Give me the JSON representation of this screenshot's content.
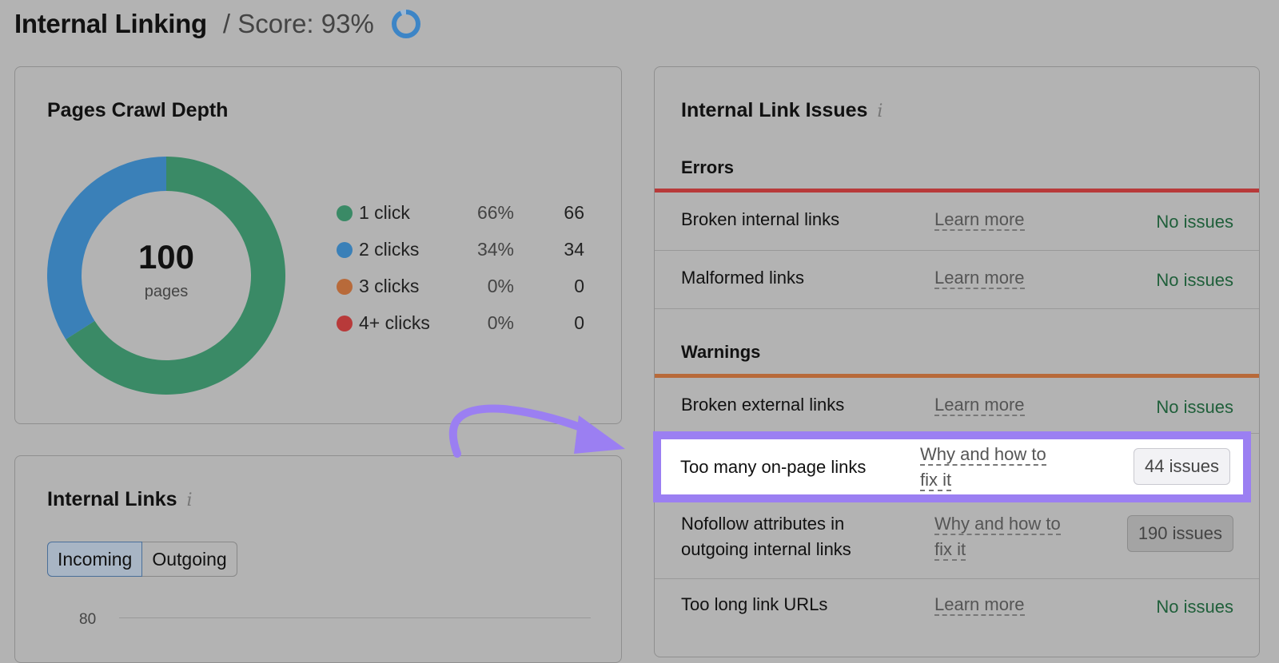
{
  "header": {
    "title": "Internal Linking",
    "score_label": "/ Score: 93%",
    "score_value": 93
  },
  "crawl_depth": {
    "title": "Pages Crawl Depth",
    "center_count": "100",
    "center_unit": "pages",
    "chart_data": {
      "type": "pie",
      "categories": [
        "1 click",
        "2 clicks",
        "3 clicks",
        "4+ clicks"
      ],
      "values": [
        66,
        34,
        0,
        0
      ],
      "colors": [
        "#3a8a66",
        "#3a80b8",
        "#b86a3a",
        "#b83a3a"
      ]
    },
    "legend": [
      {
        "label": "1 click",
        "percent": "66%",
        "value": "66",
        "color": "#3a8a66"
      },
      {
        "label": "2 clicks",
        "percent": "34%",
        "value": "34",
        "color": "#3a80b8"
      },
      {
        "label": "3 clicks",
        "percent": "0%",
        "value": "0",
        "color": "#b86a3a"
      },
      {
        "label": "4+ clicks",
        "percent": "0%",
        "value": "0",
        "color": "#b83a3a"
      }
    ]
  },
  "internal_links": {
    "title": "Internal Links",
    "info_icon": "i",
    "tabs": [
      "Incoming",
      "Outgoing"
    ],
    "axis_tick": "80"
  },
  "issues": {
    "title": "Internal Link Issues",
    "info_icon": "i",
    "errors_title": "Errors",
    "warnings_title": "Warnings",
    "errors_color": "#b83a3a",
    "warnings_color": "#b86a3a",
    "rows": [
      {
        "name": "Broken internal links",
        "link": "Learn more",
        "status": "No issues"
      },
      {
        "name": "Malformed links",
        "link": "Learn more",
        "status": "No issues"
      },
      {
        "name": "Broken external links",
        "link": "Learn more",
        "status": "No issues"
      },
      {
        "name": "Too many on-page links",
        "link_line1": "Why and how to",
        "link_line2": "fix it",
        "badge": "44 issues"
      },
      {
        "name_line1": "Nofollow attributes in",
        "name_line2": "outgoing internal links",
        "link_line1": "Why and how to",
        "link_line2": "fix it",
        "badge": "190 issues"
      },
      {
        "name": "Too long link URLs",
        "link": "Learn more",
        "status": "No issues"
      }
    ]
  }
}
